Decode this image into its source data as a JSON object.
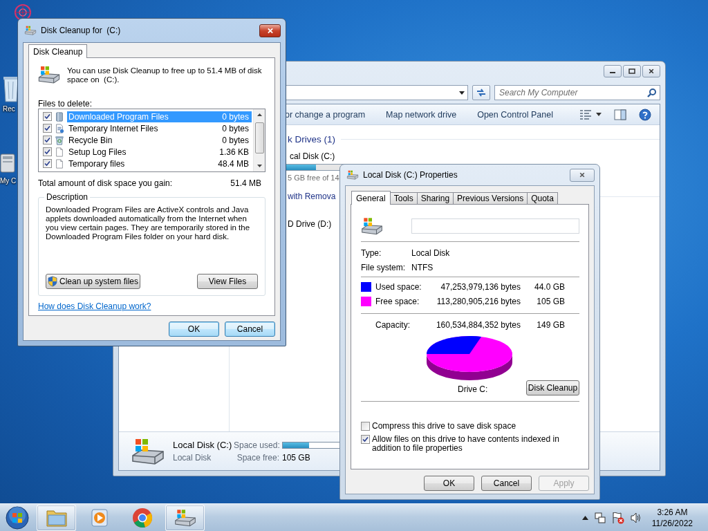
{
  "desktop_icons": [
    {
      "kind": "logo"
    },
    {
      "kind": "bin",
      "label": "Rec"
    },
    {
      "kind": "computer",
      "label": "My C"
    }
  ],
  "explorer": {
    "search": {
      "placeholder": "Search My Computer"
    },
    "toolbar": [
      "or change a program",
      "Map network drive",
      "Open Control Panel"
    ],
    "hard_drives": {
      "header": "k Drives (1)",
      "drive": {
        "name": "cal Disk (C:)",
        "level": 0.3,
        "free": "5 GB free of 14"
      }
    },
    "removable": {
      "header": "with Remova",
      "drive": {
        "name": "D Drive (D:)"
      }
    },
    "details": {
      "name": "Local Disk (C:)",
      "type": "Local Disk",
      "used_label": "Space used:",
      "level": 0.3,
      "free_label": "Space free:",
      "free": "105 GB"
    }
  },
  "properties": {
    "title": "Local Disk (C:) Properties",
    "tabs": [
      {
        "label": "General",
        "selected": true
      },
      {
        "label": "Tools",
        "selected": false
      },
      {
        "label": "Sharing",
        "selected": false
      },
      {
        "label": "Previous Versions",
        "selected": false
      },
      {
        "label": "Quota",
        "selected": false
      }
    ],
    "info": [
      {
        "label": "Type:",
        "value": "Local Disk"
      },
      {
        "label": "File system:",
        "value": "NTFS"
      }
    ],
    "space": [
      {
        "label": "Used space:",
        "bytes": "47,253,979,136 bytes",
        "size": "44.0 GB",
        "color": "#0000ff"
      },
      {
        "label": "Free space:",
        "bytes": "113,280,905,216 bytes",
        "size": "105 GB",
        "color": "#ff00ff"
      }
    ],
    "capacity": {
      "label": "Capacity:",
      "bytes": "160,534,884,352 bytes",
      "size": "149 GB"
    },
    "drive_label": "Drive C:",
    "cleanup_button": "Disk Cleanup",
    "options": [
      {
        "label": "Compress this drive to save disk space",
        "checked": false
      },
      {
        "label": "Allow files on this drive to have contents indexed in addition to file properties",
        "checked": true
      }
    ],
    "buttons": [
      {
        "label": "OK",
        "disabled": false
      },
      {
        "label": "Cancel",
        "disabled": false
      },
      {
        "label": "Apply",
        "disabled": true
      }
    ]
  },
  "disk_cleanup": {
    "title": "Disk Cleanup for  (C:)",
    "tab": "Disk Cleanup",
    "intro": "You can use Disk Cleanup to free up to 51.4 MB of disk space on  (C:).",
    "files_label": "Files to delete:",
    "files": [
      {
        "kind": "folder",
        "name": "Downloaded Program Files",
        "size": "0 bytes",
        "checked": true,
        "selected": true
      },
      {
        "kind": "internet",
        "name": "Temporary Internet Files",
        "size": "0 bytes",
        "checked": true,
        "selected": false
      },
      {
        "kind": "bin",
        "name": "Recycle Bin",
        "size": "0 bytes",
        "checked": true,
        "selected": false
      },
      {
        "kind": "file",
        "name": "Setup Log Files",
        "size": "1.36 KB",
        "checked": true,
        "selected": false
      },
      {
        "kind": "file",
        "name": "Temporary files",
        "size": "48.4 MB",
        "checked": true,
        "selected": false
      }
    ],
    "total_label": "Total amount of disk space you gain:",
    "total": "51.4 MB",
    "description_label": "Description",
    "description": "Downloaded Program Files are ActiveX controls and Java applets downloaded automatically from the Internet when you view certain pages. They are temporarily stored in the Downloaded Program Files folder on your hard disk.",
    "system_button": "Clean up system files",
    "view_button": "View Files",
    "link": "How does Disk Cleanup work?",
    "buttons": [
      "OK",
      "Cancel"
    ]
  },
  "taskbar": {
    "items": [
      {
        "kind": "start"
      },
      {
        "kind": "folder",
        "running": true
      },
      {
        "kind": "media",
        "running": false
      },
      {
        "kind": "browser",
        "running": false
      },
      {
        "kind": "drive",
        "running": true
      }
    ],
    "tray": [
      {
        "kind": "arrow"
      },
      {
        "kind": "network"
      },
      {
        "kind": "flag"
      },
      {
        "kind": "speaker"
      }
    ],
    "time": "3:26 AM",
    "date": "11/26/2022"
  }
}
